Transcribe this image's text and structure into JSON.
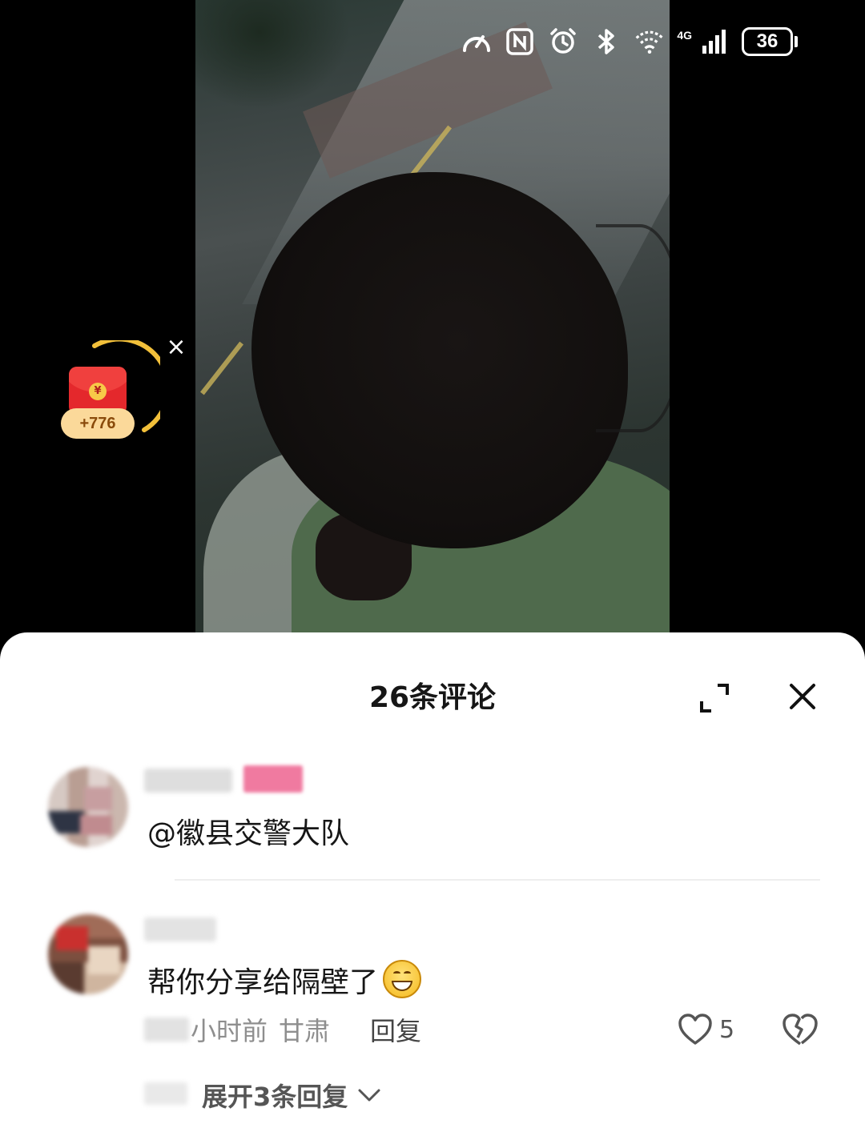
{
  "status_bar": {
    "network": "4G",
    "battery": "36",
    "icons": [
      "speedometer-icon",
      "nfc-icon",
      "alarm-icon",
      "bluetooth-icon",
      "wifi-icon",
      "signal-icon"
    ]
  },
  "red_packet": {
    "bonus": "+776",
    "coin_symbol": "¥",
    "close": "×",
    "accent": "#f2c03a"
  },
  "comments_panel": {
    "title": "26条评论",
    "expand_icon": "expand-icon",
    "close_icon": "close-icon",
    "comments": [
      {
        "text": "@徽县交警大队"
      },
      {
        "text": "帮你分享给隔壁了",
        "emoji": "grinning-face-icon",
        "time_suffix": "小时前",
        "location": "甘肃",
        "reply_label": "回复",
        "likes": "5",
        "expand_replies": "展开3条回复"
      }
    ]
  }
}
